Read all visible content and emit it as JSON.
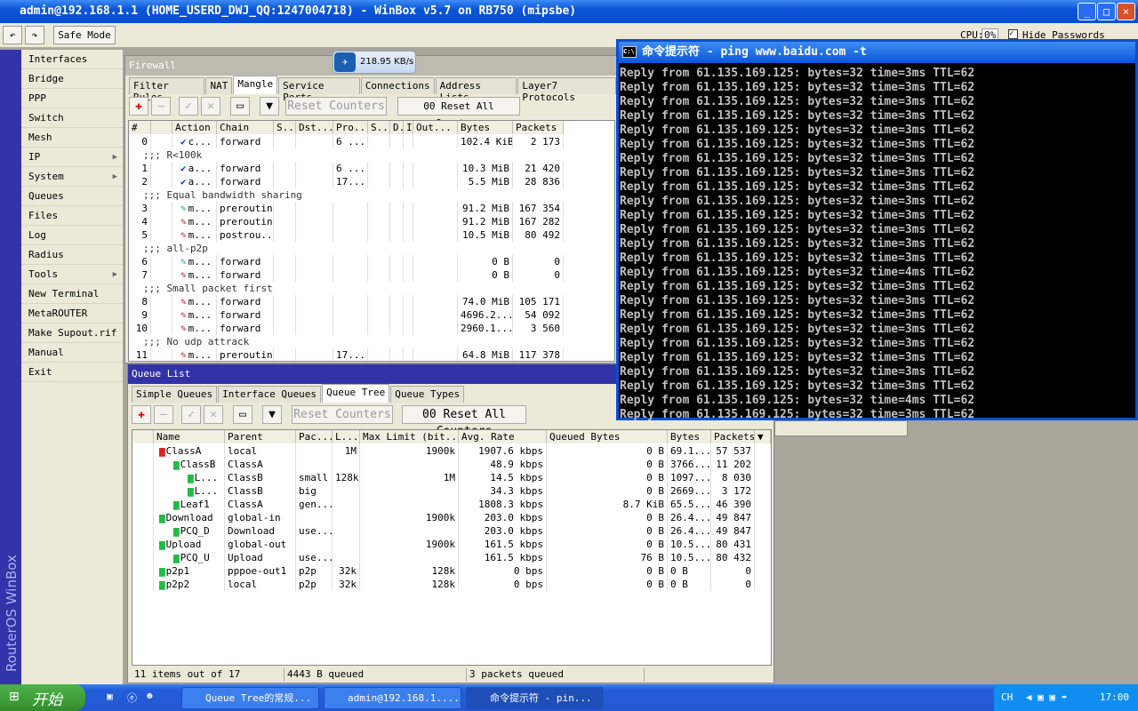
{
  "window": {
    "title": "admin@192.168.1.1 (HOME_USERD_DWJ_QQ:1247004718) - WinBox v5.7 on RB750 (mipsbe)"
  },
  "toolbar": {
    "undo": "↶",
    "redo": "↷",
    "safe_mode": "Safe Mode",
    "cpu_label": "CPU:",
    "cpu_value": "0%",
    "hide_passwords": "Hide Passwords"
  },
  "brand": "RouterOS WinBox",
  "menu": [
    {
      "label": "Interfaces"
    },
    {
      "label": "Bridge"
    },
    {
      "label": "PPP"
    },
    {
      "label": "Switch"
    },
    {
      "label": "Mesh"
    },
    {
      "label": "IP",
      "sub": true
    },
    {
      "label": "System",
      "sub": true
    },
    {
      "label": "Queues"
    },
    {
      "label": "Files"
    },
    {
      "label": "Log"
    },
    {
      "label": "Radius"
    },
    {
      "label": "Tools",
      "sub": true
    },
    {
      "label": "New Terminal"
    },
    {
      "label": "MetaROUTER"
    },
    {
      "label": "Make Supout.rif"
    },
    {
      "label": "Manual"
    },
    {
      "label": "Exit"
    }
  ],
  "speed_widget": "218.95 KB/s",
  "firewall": {
    "title": "Firewall",
    "tabs": [
      "Filter Rules",
      "NAT",
      "Mangle",
      "Service Ports",
      "Connections",
      "Address Lists",
      "Layer7 Protocols"
    ],
    "active_tab": "Mangle",
    "reset_counters": "Reset Counters",
    "reset_all": "00 Reset All Counters",
    "columns": [
      "#",
      "",
      "Action",
      "Chain",
      "S...",
      "Dst...",
      "Pro...",
      "S...",
      "D.",
      "I",
      "Out...",
      "Bytes",
      "Packets"
    ],
    "rows": [
      {
        "n": "0",
        "icon": "check",
        "action": "c...",
        "chain": "forward",
        "proto": "6 ...",
        "bytes": "102.4 KiB",
        "packets": "2 173"
      },
      {
        "comment": ";;; R<100k"
      },
      {
        "n": "1",
        "icon": "check",
        "action": "a...",
        "chain": "forward",
        "proto": "6 ...",
        "bytes": "10.3 MiB",
        "packets": "21 420"
      },
      {
        "n": "2",
        "icon": "check",
        "action": "a...",
        "chain": "forward",
        "proto": "17...",
        "bytes": "5.5 MiB",
        "packets": "28 836"
      },
      {
        "comment": ";;; Equal bandwidth sharing"
      },
      {
        "n": "3",
        "icon": "pencil-teal",
        "action": "m...",
        "chain": "prerouting",
        "proto": "",
        "bytes": "91.2 MiB",
        "packets": "167 354"
      },
      {
        "n": "4",
        "icon": "pencil-red",
        "action": "m...",
        "chain": "prerouting",
        "proto": "",
        "bytes": "91.2 MiB",
        "packets": "167 282"
      },
      {
        "n": "5",
        "icon": "pencil-red",
        "action": "m...",
        "chain": "postrou...",
        "proto": "",
        "bytes": "10.5 MiB",
        "packets": "80 492"
      },
      {
        "comment": ";;; all-p2p"
      },
      {
        "n": "6",
        "icon": "pencil-teal",
        "action": "m...",
        "chain": "forward",
        "proto": "",
        "bytes": "0 B",
        "packets": "0"
      },
      {
        "n": "7",
        "icon": "pencil-red",
        "action": "m...",
        "chain": "forward",
        "proto": "",
        "bytes": "0 B",
        "packets": "0"
      },
      {
        "comment": ";;; Small packet first"
      },
      {
        "n": "8",
        "icon": "pencil-red",
        "action": "m...",
        "chain": "forward",
        "proto": "",
        "bytes": "74.0 MiB",
        "packets": "105 171"
      },
      {
        "n": "9",
        "icon": "pencil-red",
        "action": "m...",
        "chain": "forward",
        "proto": "",
        "bytes": "4696.2...",
        "packets": "54 092"
      },
      {
        "n": "10",
        "icon": "pencil-red",
        "action": "m...",
        "chain": "forward",
        "proto": "",
        "bytes": "2960.1...",
        "packets": "3 560"
      },
      {
        "comment": ";;; No udp attrack"
      },
      {
        "n": "11",
        "icon": "pencil-red",
        "action": "m...",
        "chain": "prerouting",
        "proto": "17...",
        "bytes": "64.8 MiB",
        "packets": "117 378"
      }
    ]
  },
  "queue": {
    "title": "Queue List",
    "tabs": [
      "Simple Queues",
      "Interface Queues",
      "Queue Tree",
      "Queue Types"
    ],
    "active_tab": "Queue Tree",
    "reset_counters": "Reset Counters",
    "reset_all": "00 Reset All Counters",
    "columns": [
      "",
      "Name",
      "Parent",
      "Pac...",
      "L...",
      "Max Limit (bit...",
      "Avg. Rate",
      "Queued Bytes",
      "Bytes",
      "Packets"
    ],
    "rows": [
      {
        "indent": 0,
        "color": "red",
        "name": "ClassA",
        "parent": "local",
        "pac": "",
        "lim": "1M",
        "max": "1900k",
        "rate": "1907.6 kbps",
        "queued": "0 B",
        "bytes": "69.1...",
        "packets": "57 537"
      },
      {
        "indent": 1,
        "color": "green",
        "name": "ClassB",
        "parent": "ClassA",
        "pac": "",
        "lim": "",
        "max": "",
        "rate": "48.9 kbps",
        "queued": "0 B",
        "bytes": "3766...",
        "packets": "11 202"
      },
      {
        "indent": 2,
        "color": "green",
        "name": "L...",
        "parent": "ClassB",
        "pac": "small",
        "lim": "128k",
        "max": "1M",
        "rate": "14.5 kbps",
        "queued": "0 B",
        "bytes": "1097...",
        "packets": "8 030"
      },
      {
        "indent": 2,
        "color": "green",
        "name": "L...",
        "parent": "ClassB",
        "pac": "big",
        "lim": "",
        "max": "",
        "rate": "34.3 kbps",
        "queued": "0 B",
        "bytes": "2669...",
        "packets": "3 172"
      },
      {
        "indent": 1,
        "color": "green",
        "name": "Leaf1",
        "parent": "ClassA",
        "pac": "gen...",
        "lim": "",
        "max": "",
        "rate": "1808.3 kbps",
        "queued": "8.7 KiB",
        "bytes": "65.5...",
        "packets": "46 390"
      },
      {
        "indent": 0,
        "color": "green",
        "name": "Download",
        "parent": "global-in",
        "pac": "",
        "lim": "",
        "max": "1900k",
        "rate": "203.0 kbps",
        "queued": "0 B",
        "bytes": "26.4...",
        "packets": "49 847"
      },
      {
        "indent": 1,
        "color": "green",
        "name": "PCQ_D",
        "parent": "Download",
        "pac": "use...",
        "lim": "",
        "max": "",
        "rate": "203.0 kbps",
        "queued": "0 B",
        "bytes": "26.4...",
        "packets": "49 847"
      },
      {
        "indent": 0,
        "color": "green",
        "name": "Upload",
        "parent": "global-out",
        "pac": "",
        "lim": "",
        "max": "1900k",
        "rate": "161.5 kbps",
        "queued": "0 B",
        "bytes": "10.5...",
        "packets": "80 431"
      },
      {
        "indent": 1,
        "color": "green",
        "name": "PCQ_U",
        "parent": "Upload",
        "pac": "use...",
        "lim": "",
        "max": "",
        "rate": "161.5 kbps",
        "queued": "76 B",
        "bytes": "10.5...",
        "packets": "80 432"
      },
      {
        "indent": 0,
        "color": "green",
        "name": "p2p1",
        "parent": "pppoe-out1",
        "pac": "p2p",
        "lim": "32k",
        "max": "128k",
        "rate": "0 bps",
        "queued": "0 B",
        "bytes": "0 B",
        "packets": "0"
      },
      {
        "indent": 0,
        "color": "green",
        "name": "p2p2",
        "parent": "local",
        "pac": "p2p",
        "lim": "32k",
        "max": "128k",
        "rate": "0 bps",
        "queued": "0 B",
        "bytes": "0 B",
        "packets": "0"
      }
    ],
    "status": {
      "items": "11 items out of 17",
      "bytes": "4443 B queued",
      "packets": "3 packets queued"
    }
  },
  "cmd": {
    "title": "命令提示符 - ping www.baidu.com -t",
    "times": [
      "3",
      "3",
      "3",
      "3",
      "3",
      "3",
      "3",
      "3",
      "3",
      "3",
      "3",
      "3",
      "3",
      "3",
      "4",
      "3",
      "3",
      "3",
      "3",
      "3",
      "3",
      "3",
      "3",
      "4",
      "3"
    ],
    "line_prefix": "Reply from 61.135.169.125: bytes=32 time=",
    "line_suffix": "ms TTL=62"
  },
  "taskbar": {
    "start": "开始",
    "tasks": [
      "Queue Tree的常规...",
      "admin@192.168.1....",
      "命令提示符 - pin..."
    ],
    "lang": "CH",
    "clock": "17:00"
  },
  "colors": {
    "titlebar": "#0a55d8",
    "winbox_strip": "#3333aa",
    "queue_red": "#dd2222",
    "queue_green": "#22bb44"
  }
}
